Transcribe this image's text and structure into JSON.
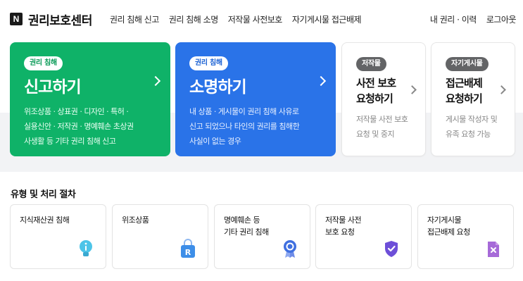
{
  "header": {
    "logo_glyph": "N",
    "brand": "권리보호센터",
    "nav": [
      "권리 침해 신고",
      "권리 침해 소명",
      "저작물 사전보호",
      "자기게시물 접근배제"
    ],
    "util": [
      "내 권리 · 이력",
      "로그아웃"
    ]
  },
  "hero": {
    "report": {
      "badge": "권리 침해",
      "title": "신고하기",
      "desc": "위조상품 · 상표권 · 디자인 · 특허 ·\n실용신안 · 저작권 · 명예훼손 초상권\n사생활 등 기타 권리 침해 신고",
      "color": "#0fb268"
    },
    "explain": {
      "badge": "권리 침해",
      "title": "소명하기",
      "desc": "내 상품 · 게시물이 권리 침해 사유로\n신고 되었으나 타인의 권리를 침해한\n사실이 없는 경우",
      "color": "#2a73e8"
    },
    "preprotect": {
      "badge": "저작물",
      "title": "사전 보호\n요청하기",
      "desc": "저작물 사전 보호\n요청 및 중지"
    },
    "exclude": {
      "badge": "자기게시물",
      "title": "접근배제\n요청하기",
      "desc": "게시물 작성자 및\n유족 요청 가능"
    }
  },
  "types": {
    "title": "유형 및 처리 절차",
    "items": [
      {
        "label": "지식재산권 침해",
        "icon": "lightbulb-icon",
        "color": "#4cc4e8"
      },
      {
        "label": "위조상품",
        "icon": "shopping-bag-r-icon",
        "color": "#3d8ee8"
      },
      {
        "label": "명예훼손 등\n기타 권리 침해",
        "icon": "medal-icon",
        "color": "#3f6fe0"
      },
      {
        "label": "저작물 사전\n보호 요청",
        "icon": "shield-check-icon",
        "color": "#6d4fd8"
      },
      {
        "label": "자기게시물\n접근배제 요청",
        "icon": "document-x-icon",
        "color": "#a66ad8"
      }
    ]
  }
}
